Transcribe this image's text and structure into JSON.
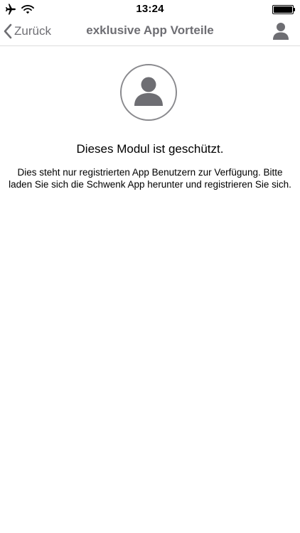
{
  "status_bar": {
    "time": "13:24",
    "icons": [
      "airplane-mode-icon",
      "wifi-icon",
      "battery-icon"
    ],
    "battery_level": 1.0
  },
  "nav_bar": {
    "back_label": "Zurück",
    "title": "exklusive App Vorteile",
    "back_icon": "chevron-left-icon",
    "right_icon": "user-profile-icon"
  },
  "content": {
    "avatar_icon": "user-avatar-icon",
    "heading": "Dieses Modul ist geschützt.",
    "message": "Dies steht nur registrierten App Benutzern zur Verfügung. Bitte laden Sie sich die Schwenk App herunter und registrieren Sie sich."
  },
  "colors": {
    "nav_text": "#6e6e73",
    "icon_gray": "#8a8a8e",
    "divider": "#dcdcdc",
    "background": "#ffffff"
  }
}
